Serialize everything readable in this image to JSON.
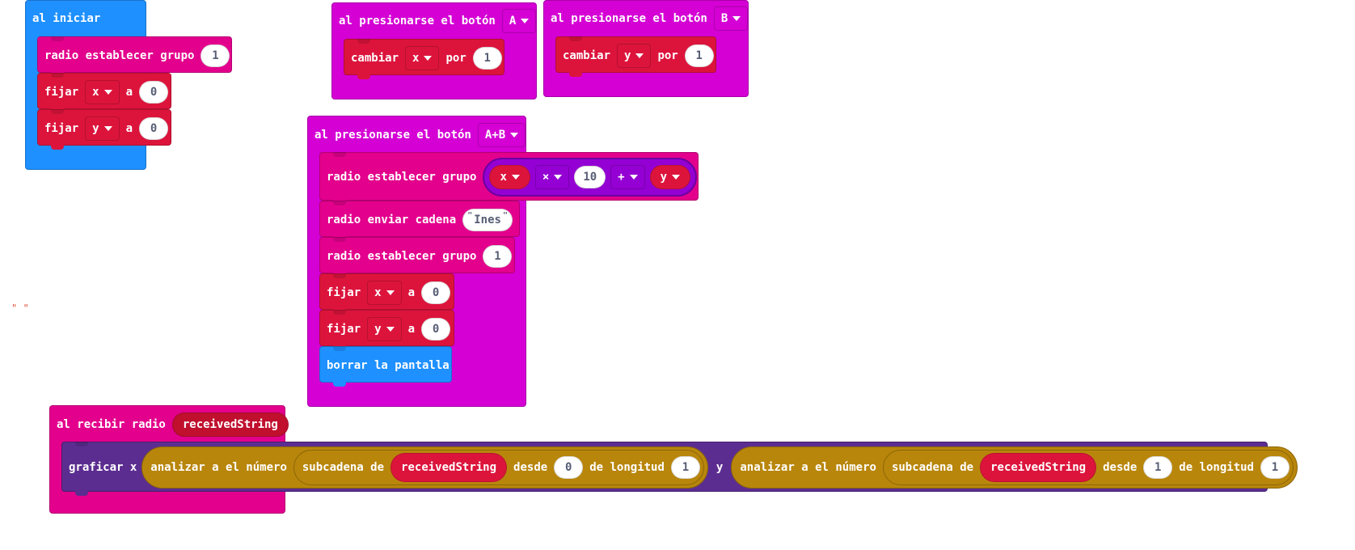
{
  "colors": {
    "events_blue": "#1e90ff",
    "radio_pink": "#e3008c",
    "variables_red": "#dc143c",
    "input_purple": "#d400d4",
    "math_purple": "#9400d3",
    "text_gold": "#b8860b",
    "led_purple": "#5c2d91"
  },
  "on_start": {
    "label": "al iniciar",
    "radio_group_label": "radio establecer grupo",
    "radio_group_value": "1",
    "set_x": {
      "label": "fijar",
      "var": "x",
      "to": "a",
      "value": "0"
    },
    "set_y": {
      "label": "fijar",
      "var": "y",
      "to": "a",
      "value": "0"
    }
  },
  "button_a": {
    "label": "al presionarse el botón",
    "button": "A",
    "change_label": "cambiar",
    "var": "x",
    "by": "por",
    "value": "1"
  },
  "button_b": {
    "label": "al presionarse el botón",
    "button": "B",
    "change_label": "cambiar",
    "var": "y",
    "by": "por",
    "value": "1"
  },
  "button_ab": {
    "label": "al presionarse el botón",
    "button": "A+B",
    "radio_group_label": "radio establecer grupo",
    "expr": {
      "var1": "x",
      "op1": "×",
      "num": "10",
      "op2": "+",
      "var2": "y"
    },
    "send_label": "radio enviar cadena",
    "send_value": "Ines",
    "quote": "\"",
    "radio_group2_label": "radio establecer grupo",
    "radio_group2_value": "1",
    "set_x": {
      "label": "fijar",
      "var": "x",
      "to": "a",
      "value": "0"
    },
    "set_y": {
      "label": "fijar",
      "var": "y",
      "to": "a",
      "value": "0"
    },
    "clear_label": "borrar la pantalla"
  },
  "stray_comment": "\" \"",
  "on_receive": {
    "label": "al recibir radio",
    "param": "receivedString",
    "plot_label": "graficar x",
    "parse1_label": "analizar a el número",
    "substr1_label": "subcadena de",
    "substr1_var": "receivedString",
    "from1_label": "desde",
    "from1_value": "0",
    "len1_label": "de longitud",
    "len1_value": "1",
    "y_label": "y",
    "parse2_label": "analizar a el número",
    "substr2_label": "subcadena de",
    "substr2_var": "receivedString",
    "from2_label": "desde",
    "from2_value": "1",
    "len2_label": "de longitud",
    "len2_value": "1"
  }
}
